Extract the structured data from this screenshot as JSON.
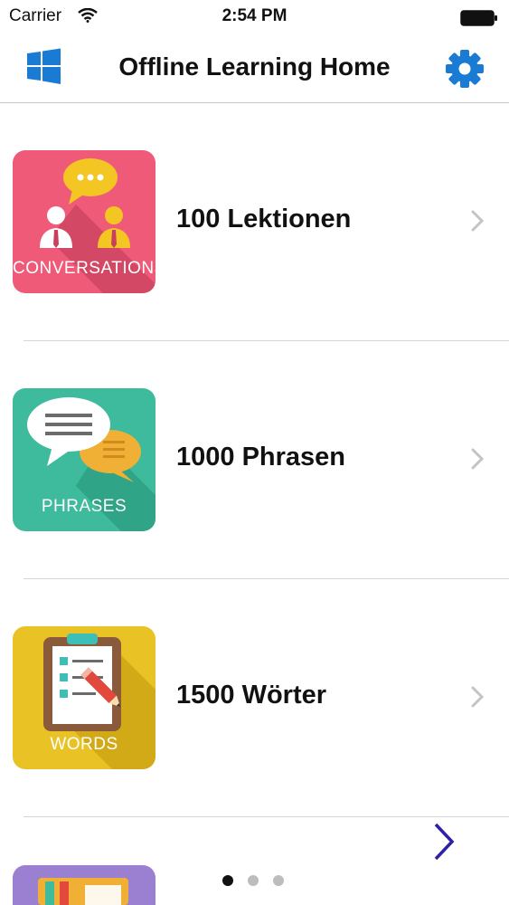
{
  "status_bar": {
    "carrier": "Carrier",
    "time": "2:54 PM"
  },
  "nav": {
    "title": "Offline Learning Home",
    "left_icon": "windows-logo-icon",
    "right_icon": "gear-icon",
    "accent": "#1a7bd4"
  },
  "items": [
    {
      "label": "100 Lektionen",
      "caption": "CONVERSATIONS",
      "color": "#ee5a78"
    },
    {
      "label": "1000 Phrasen",
      "caption": "PHRASES",
      "color": "#3dbb9c"
    },
    {
      "label": "1500 Wörter",
      "caption": "WORDS",
      "color": "#e9c225"
    },
    {
      "color": "#9b7fd0"
    }
  ],
  "pager": {
    "pages": 3,
    "current": 1,
    "arrow_color": "#2e20a8"
  }
}
